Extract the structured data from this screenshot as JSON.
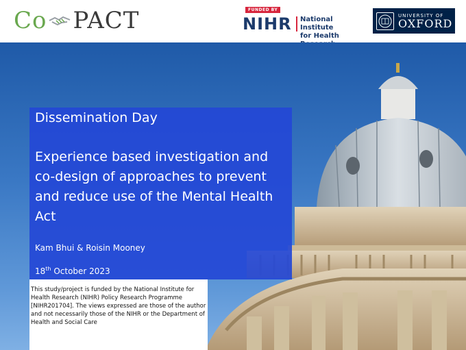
{
  "header": {
    "copact_logo": {
      "co": "Co",
      "pact": "PACT",
      "icon": "handshake-icon"
    },
    "nihr_logo": {
      "funded_by": "FUNDED BY",
      "mark": "NIHR",
      "line1": "National Institute",
      "line2": "for Health Research",
      "accent": "#d7263d",
      "brand": "#1b3a6b"
    },
    "oxford_logo": {
      "university_of": "UNIVERSITY OF",
      "name": "OXFORD",
      "icon": "oxford-crest-icon",
      "brand": "#002147"
    }
  },
  "slide": {
    "title": "Dissemination Day",
    "subtitle": "Experience based investigation and co-design of approaches to prevent and reduce use of the Mental Health Act",
    "authors": "Kam Bhui & Roisin Mooney",
    "date": {
      "day": "18",
      "suffix": "th",
      "rest": " October 2023"
    },
    "funding_statement": "This study/project is funded by the National Institute for Health Research (NIHR) Policy Research Programme [NIHR201704]. The views expressed are those of the author and not necessarily those of the NIHR or the Department of Health and Social Care",
    "title_box_color": "#2448d6",
    "background": "radcliffe-camera-building"
  }
}
